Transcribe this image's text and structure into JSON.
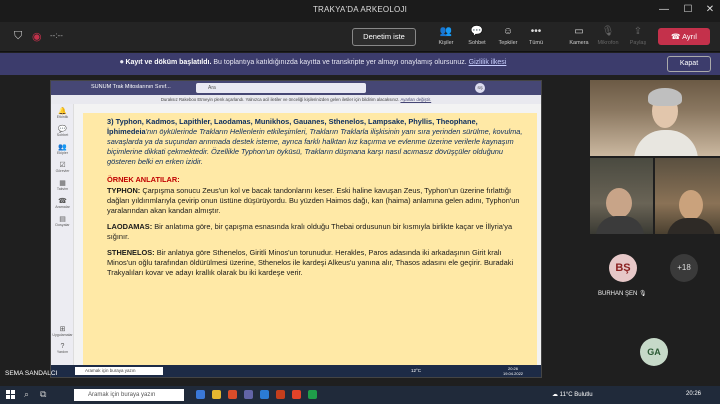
{
  "window": {
    "title": "TRAKYA'DA ARKEOLOJI"
  },
  "toolbar": {
    "timer": "--:--",
    "leave_early": "Denetim iste",
    "controls": [
      {
        "label": "Kişiler",
        "icon": "people-icon"
      },
      {
        "label": "Sohbet",
        "icon": "chat-icon"
      },
      {
        "label": "Tepkiler",
        "icon": "reaction-icon"
      },
      {
        "label": "Tümü",
        "icon": "more-icon"
      },
      {
        "label": "Kamera",
        "icon": "camera-icon"
      },
      {
        "label": "Mikrofon",
        "icon": "mic-icon"
      },
      {
        "label": "Paylaş",
        "icon": "share-icon"
      }
    ],
    "leave": "Ayrıl"
  },
  "banner": {
    "bold": "Kayıt ve döküm başlatıldı.",
    "text": " Bu toplantıya katıldığınızda kayıtta ve transkripte yer almayı onaylamış olursunuz.",
    "link": "Gizlilik ilkesi",
    "close": "Kapat"
  },
  "share": {
    "meeting_name": "SUNUM Trak Mitoslarının Sınıf...",
    "search": "Ara",
    "avatar": "SŞ",
    "notice": "Duraksız Rakeboo Etmeyin plenk açarlandı. Yalnızca acil iletiler ve önceliği kişilerinizden gelen iletiler için bildirim alacaksınız.",
    "notice_link": "Ayarları değiştir.",
    "rail": [
      "Etkinlik",
      "Sohbet",
      "Ekipler",
      "Görevler",
      "Takvim",
      "Aramalar",
      "Dosyalar",
      "Uygulamalar",
      "Yardım"
    ],
    "doc": {
      "intro_num": "3)",
      "intro_names": "Typhon, Kadmos, Lapithler, Laodamas, Munikhos, Gauanes, Sthenelos, Lampsake, Phyllis, Theophane, İphimedeia",
      "intro_rest": "'nın öykülerinde Trakların Hellenlerin etkileşimleri, Trakların Traklarla ilişkisinin yanı sıra yerinden sürülme, kovulma, savaşlarda ya da suçundan arınmada destek isteme, ayrıca farklı halktan kız kaçırma ve evlenme üzerine verilerle kaynaşım biçimlerine dikkati çekmektedir. Özellikle Typhon'un öyküsü, Trakların düşmana karşı nasıl acımasız dövüşçüler olduğunu gösteren belki en erken izidir.",
      "section": "ÖRNEK ANLATILAR:",
      "entries": [
        {
          "name": "TYPHON:",
          "text": " Çarpışma sonucu Zeus'un kol ve bacak tandonlarını keser. Eski haline kavuşan Zeus, Typhon'un üzerine fırlattığı dağları yıldırımlarıyla çevirip onun üstüne düşürüyordu. Bu yüzden Haimos dağı, kan (haima) anlamına gelen adını, Typhon'un yaralarından akan kandan almıştır."
        },
        {
          "name": "LAODAMAS:",
          "text": " Bir anlatıma göre, bir çapışma esnasında kralı olduğu Thebai ordusunun bir kısmıyla birlikte kaçar ve İllyria'ya sığınır."
        },
        {
          "name": "STHENELOS:",
          "text": " Bir anlatıya göre Sthenelos, Giritli Minos'un torunudur. Herakles, Paros adasında iki arkadaşının Girit kralı Minos'un oğlu tarafından öldürülmesi üzerine, Sthenelos ile kardeşi Alkeus'u yanına alır, Thasos adasını ele geçirir. Buradaki Trakyalıları kovar ve adayı krallık olarak bu iki kardeşe verir."
        }
      ]
    },
    "taskbar": {
      "search": "Aramak için buraya yazın",
      "temp": "12°C",
      "time": "20:26",
      "date": "19.04.2022"
    }
  },
  "participants": {
    "bs_initials": "BŞ",
    "more": "+18",
    "burhan": "BURHAN ŞEN",
    "ga_initials": "GA"
  },
  "presenter": "SEMA SANDALCI",
  "taskbar": {
    "search": "Aramak için buraya yazın",
    "weather": "11°C  Bulutlu",
    "time": "20:26"
  }
}
